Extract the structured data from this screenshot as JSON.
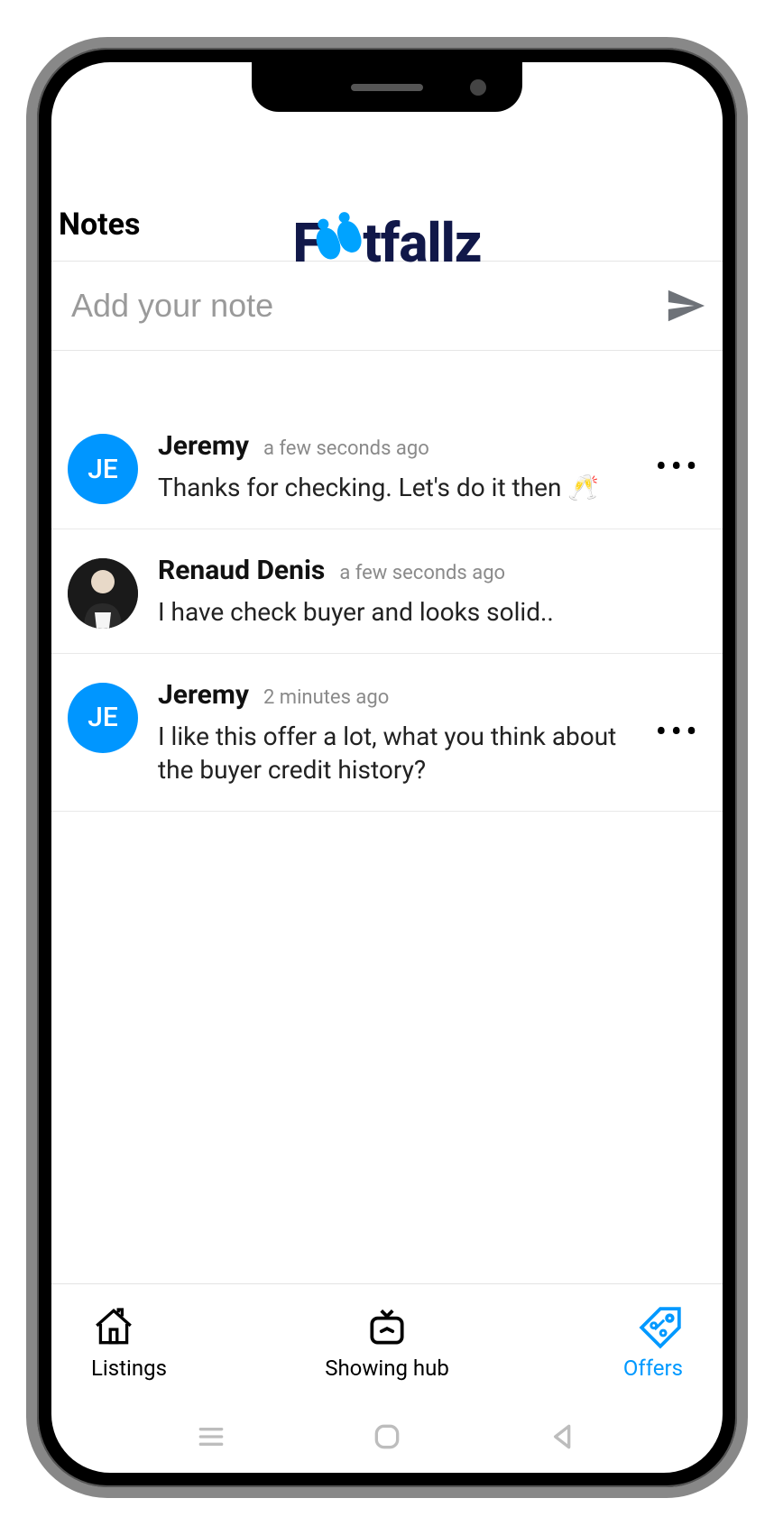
{
  "page": {
    "title": "Notes"
  },
  "brand": {
    "name": "Footfallz",
    "prefix": "F",
    "suffix": "tfallz"
  },
  "input": {
    "placeholder": "Add your note",
    "send_icon": "send-icon"
  },
  "notes": [
    {
      "author": "Jeremy",
      "initials": "JE",
      "avatar_type": "initials",
      "time": "a few seconds ago",
      "text": "Thanks for checking. Let's do it then 🥂",
      "has_menu": true
    },
    {
      "author": "Renaud Denis",
      "initials": "",
      "avatar_type": "photo",
      "time": "a few seconds ago",
      "text": "I have check buyer and looks solid..",
      "has_menu": false
    },
    {
      "author": "Jeremy",
      "initials": "JE",
      "avatar_type": "initials",
      "time": "2 minutes ago",
      "text": "I like this offer a lot, what you think about the buyer credit history?",
      "has_menu": true
    }
  ],
  "tabs": [
    {
      "id": "listings",
      "label": "Listings",
      "icon": "home-icon",
      "active": false
    },
    {
      "id": "showing",
      "label": "Showing hub",
      "icon": "tv-icon",
      "active": false
    },
    {
      "id": "offers",
      "label": "Offers",
      "icon": "tag-icon",
      "active": true
    }
  ],
  "android_nav": {
    "recent": "recent-apps",
    "home": "home",
    "back": "back"
  },
  "colors": {
    "accent": "#0099ff",
    "brand_dark": "#111849"
  }
}
